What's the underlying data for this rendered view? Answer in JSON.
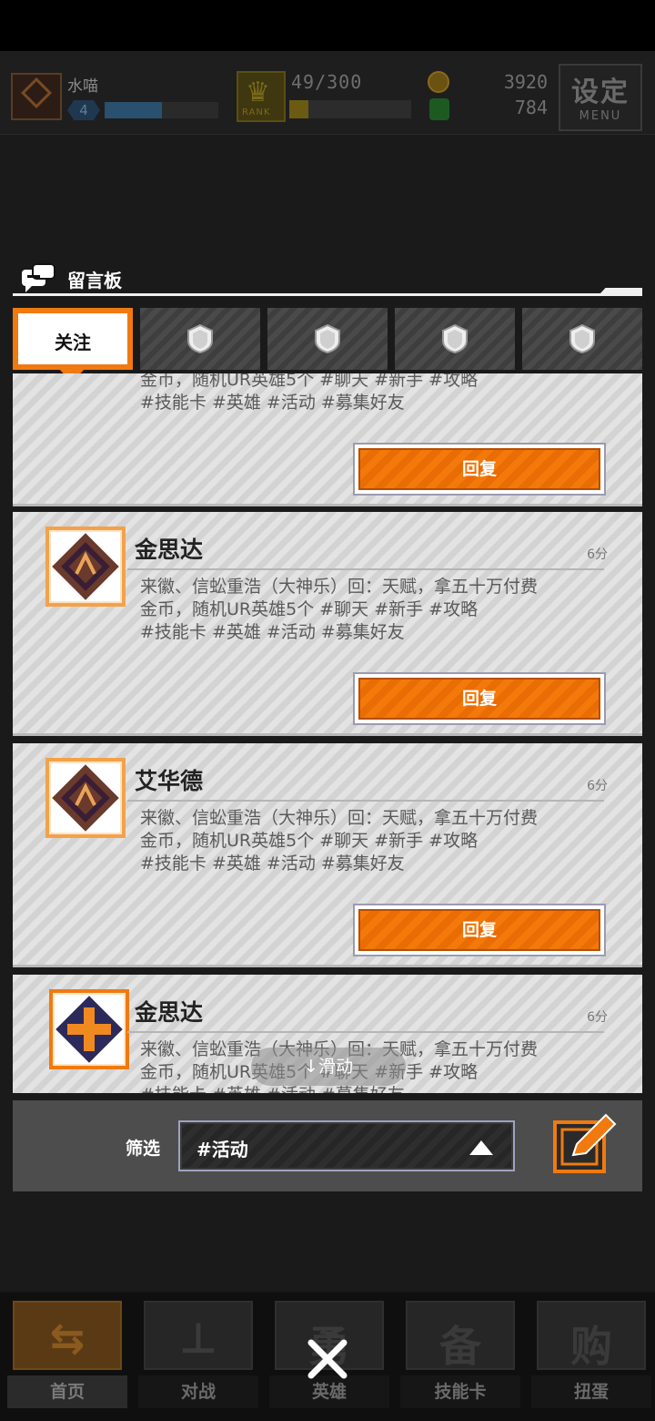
{
  "hud": {
    "player_name": "水喵",
    "level": "4",
    "exp_fraction": 0.5,
    "rank_label": "RANK",
    "rank_counter": "49/300",
    "rank_fraction": 0.16,
    "gold": "3920",
    "gems": "784",
    "menu_cn": "设定",
    "menu_en": "MENU"
  },
  "board": {
    "title": "留言板",
    "tabs": [
      {
        "label": "关注",
        "active": true
      },
      {
        "label": "",
        "icon": "shield-icon"
      },
      {
        "label": "",
        "icon": "shield-icon"
      },
      {
        "label": "",
        "icon": "shield-icon"
      },
      {
        "label": "",
        "icon": "shield-icon"
      }
    ],
    "posts": [
      {
        "name": "",
        "time": "",
        "text": "来徽、信蚣重浩（大神乐）回：天赋，拿五十万付费\n金币，随机UR英雄5个 #聊天 #新手 #攻略\n#技能卡 #英雄 #活动 #募集好友",
        "reply": "回复"
      },
      {
        "name": "金思达",
        "time": "6分",
        "text": "来徽、信蚣重浩（大神乐）回：天赋，拿五十万付费\n金币，随机UR英雄5个 #聊天 #新手 #攻略\n#技能卡 #英雄 #活动 #募集好友",
        "reply": "回复",
        "avatar": "rune-emblem-icon"
      },
      {
        "name": "艾华德",
        "time": "6分",
        "text": "来徽、信蚣重浩（大神乐）回：天赋，拿五十万付费\n金币，随机UR英雄5个 #聊天 #新手 #攻略\n#技能卡 #英雄 #活动 #募集好友",
        "reply": "回复",
        "avatar": "rune-emblem-icon"
      },
      {
        "name": "金思达",
        "time": "6分",
        "text": "来徽、信蚣重浩（大神乐）回：天赋，拿五十万付费\n金币，随机UR英雄5个 #聊天 #新手 #攻略\n#技能卡 #英雄 #活动 #募集好友",
        "reply": "回复",
        "avatar": "cross-emblem-icon"
      }
    ],
    "scroll_hint": "↓滑动",
    "filter_label": "筛选",
    "filter_value": "#活动"
  },
  "nav": {
    "items": [
      {
        "label": "首页",
        "glyph": "⇆"
      },
      {
        "label": "对战",
        "glyph": "⊥"
      },
      {
        "label": "英雄",
        "glyph": "勇"
      },
      {
        "label": "技能卡",
        "glyph": "备"
      },
      {
        "label": "扭蛋",
        "glyph": "购"
      }
    ]
  },
  "colors": {
    "accent": "#f07a10",
    "card_bg": "#dddddd",
    "panel_dark": "#4d4d4d"
  }
}
